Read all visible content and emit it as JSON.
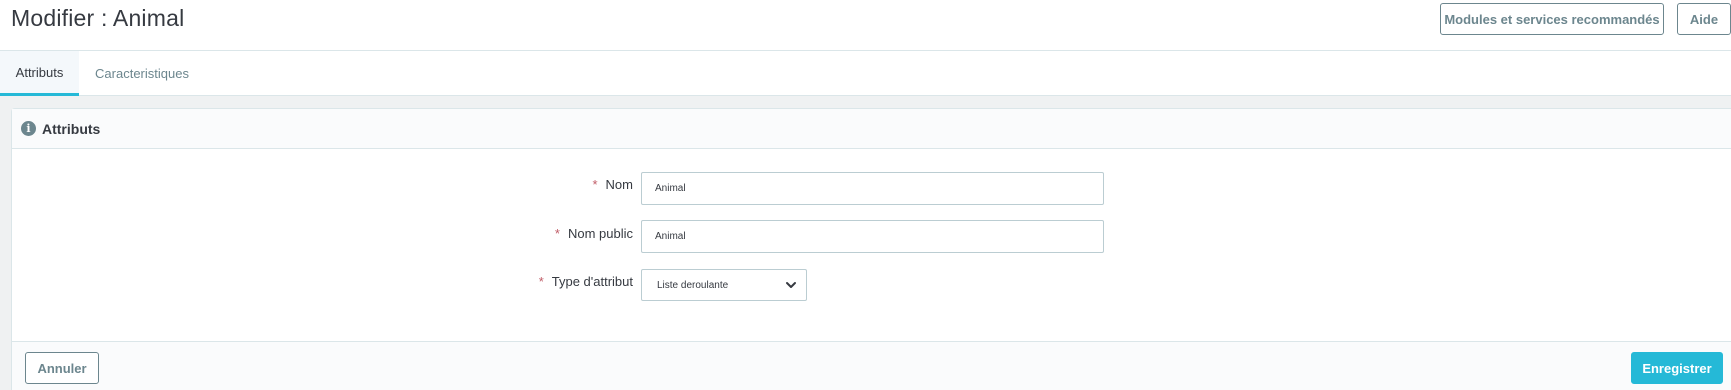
{
  "header": {
    "title": "Modifier : Animal",
    "modules_button": "Modules et services recommandés",
    "help_button": "Aide"
  },
  "tabs": [
    {
      "label": "Attributs",
      "active": true
    },
    {
      "label": "Caracteristiques",
      "active": false
    }
  ],
  "panel": {
    "icon": "info-icon",
    "title": "Attributs",
    "required_marker": "*",
    "fields": {
      "nom": {
        "label": "Nom",
        "value": "Animal"
      },
      "nom_public": {
        "label": "Nom public",
        "value": "Animal"
      },
      "type": {
        "label": "Type d'attribut",
        "value": "Liste deroulante"
      }
    }
  },
  "footer": {
    "cancel_button": "Annuler",
    "save_button": "Enregistrer"
  },
  "colors": {
    "accent": "#25b9d7",
    "required": "#c05c67",
    "text": "#363a41",
    "muted": "#6c868e"
  }
}
